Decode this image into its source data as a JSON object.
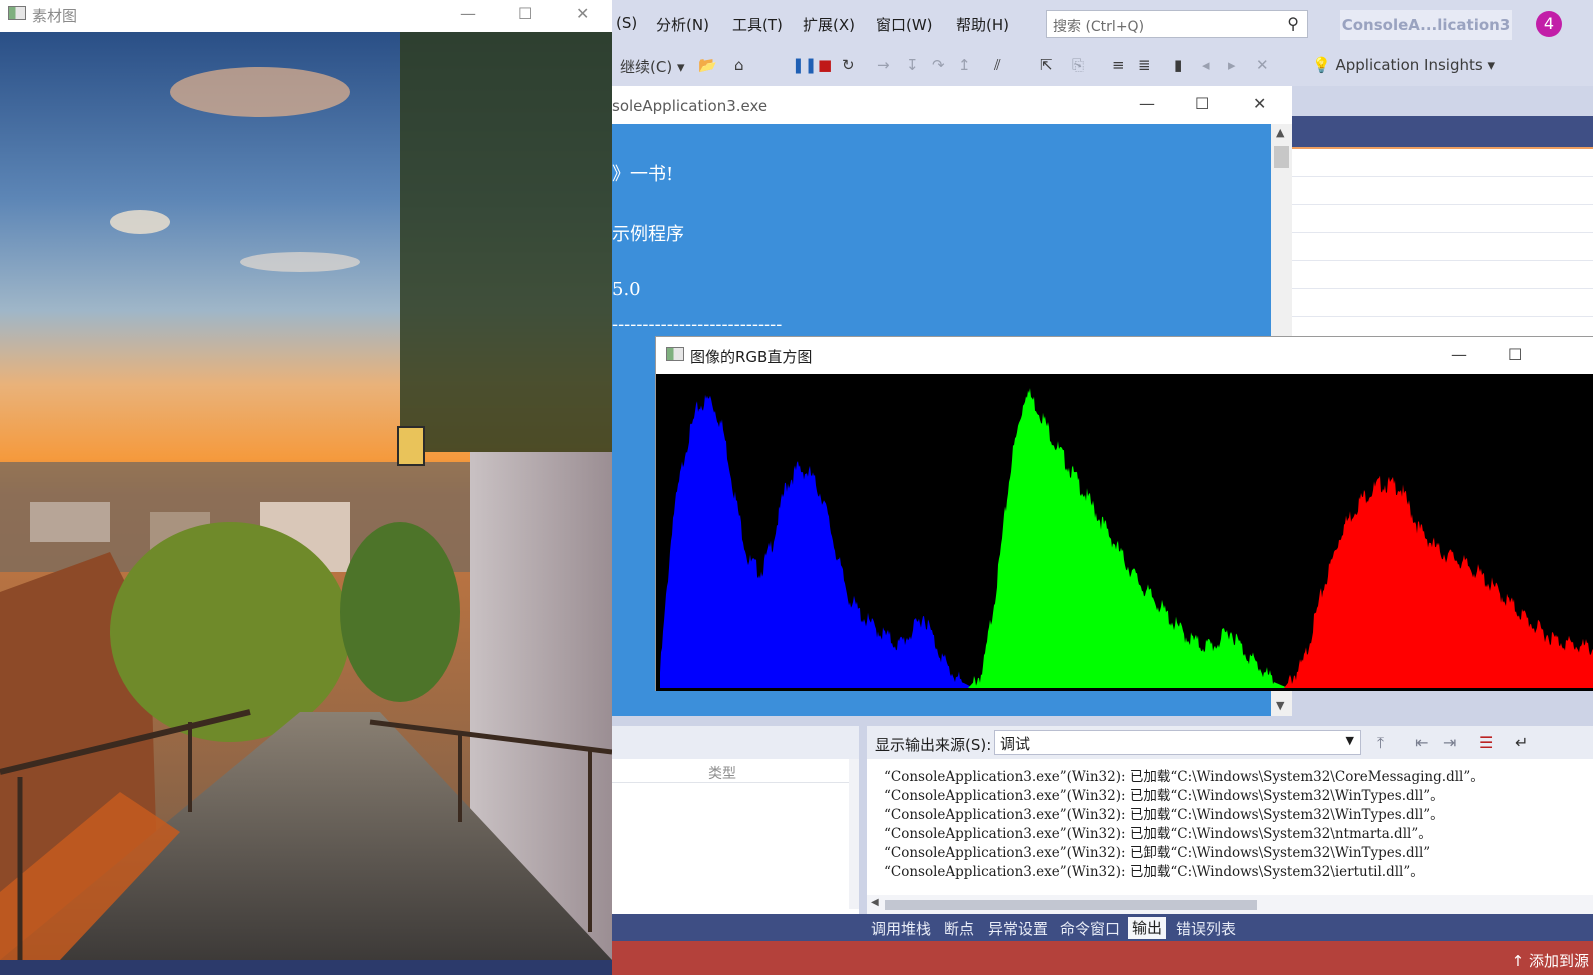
{
  "vs": {
    "menu": [
      "(S)",
      "分析(N)",
      "工具(T)",
      "扩展(X)",
      "窗口(W)",
      "帮助(H)"
    ],
    "search_placeholder": "搜索 (Ctrl+Q)",
    "solution_title": "ConsoleA...lication3",
    "avatar_count": "4",
    "toolbar": {
      "continue_label": "继续(C)",
      "app_insights_label": "Application Insights"
    },
    "output": {
      "source_label": "显示输出来源(S):",
      "source_value": "调试",
      "lines": [
        "“ConsoleApplication3.exe”(Win32): 已加载“C:\\Windows\\System32\\CoreMessaging.dll”。",
        "“ConsoleApplication3.exe”(Win32): 已加载“C:\\Windows\\System32\\WinTypes.dll”。",
        "“ConsoleApplication3.exe”(Win32): 已加载“C:\\Windows\\System32\\WinTypes.dll”。",
        "“ConsoleApplication3.exe”(Win32): 已加载“C:\\Windows\\System32\\ntmarta.dll”。",
        "“ConsoleApplication3.exe”(Win32): 已卸载“C:\\Windows\\System32\\WinTypes.dll”",
        "“ConsoleApplication3.exe”(Win32): 已加载“C:\\Windows\\System32\\iertutil.dll”。"
      ]
    },
    "left_panel": {
      "col_type": "类型"
    },
    "bottom_tabs": [
      "调用堆栈",
      "断点",
      "异常设置",
      "命令窗口",
      "输出",
      "错误列表"
    ],
    "active_tab": "输出",
    "status_add": "添加到源"
  },
  "console": {
    "title": "soleApplication3.exe",
    "lines": [
      "》一书!",
      "示例程序",
      "5.0",
      "----------------------------"
    ]
  },
  "histogram": {
    "title": "图像的RGB直方图",
    "colors": {
      "blue": "#0000ff",
      "green": "#00ff00",
      "red": "#ff0000"
    },
    "bin_count": 256,
    "shape_note_blue": [
      0.05,
      0.55,
      0.78,
      0.92,
      0.95,
      0.85,
      0.62,
      0.42,
      0.38,
      0.48,
      0.66,
      0.72,
      0.7,
      0.62,
      0.45,
      0.3,
      0.24,
      0.2,
      0.17,
      0.14,
      0.18,
      0.24,
      0.14,
      0.06,
      0.02,
      0.0
    ],
    "shape_note_green": [
      0.0,
      0.05,
      0.35,
      0.75,
      0.98,
      0.9,
      0.8,
      0.72,
      0.64,
      0.56,
      0.48,
      0.4,
      0.33,
      0.28,
      0.22,
      0.17,
      0.14,
      0.14,
      0.19,
      0.12,
      0.07,
      0.02,
      0.0
    ],
    "shape_note_red": [
      0.0,
      0.08,
      0.32,
      0.52,
      0.62,
      0.67,
      0.66,
      0.52,
      0.45,
      0.42,
      0.38,
      0.32,
      0.26,
      0.2,
      0.16,
      0.14,
      0.13
    ]
  },
  "source_image": {
    "title": "素材图"
  }
}
